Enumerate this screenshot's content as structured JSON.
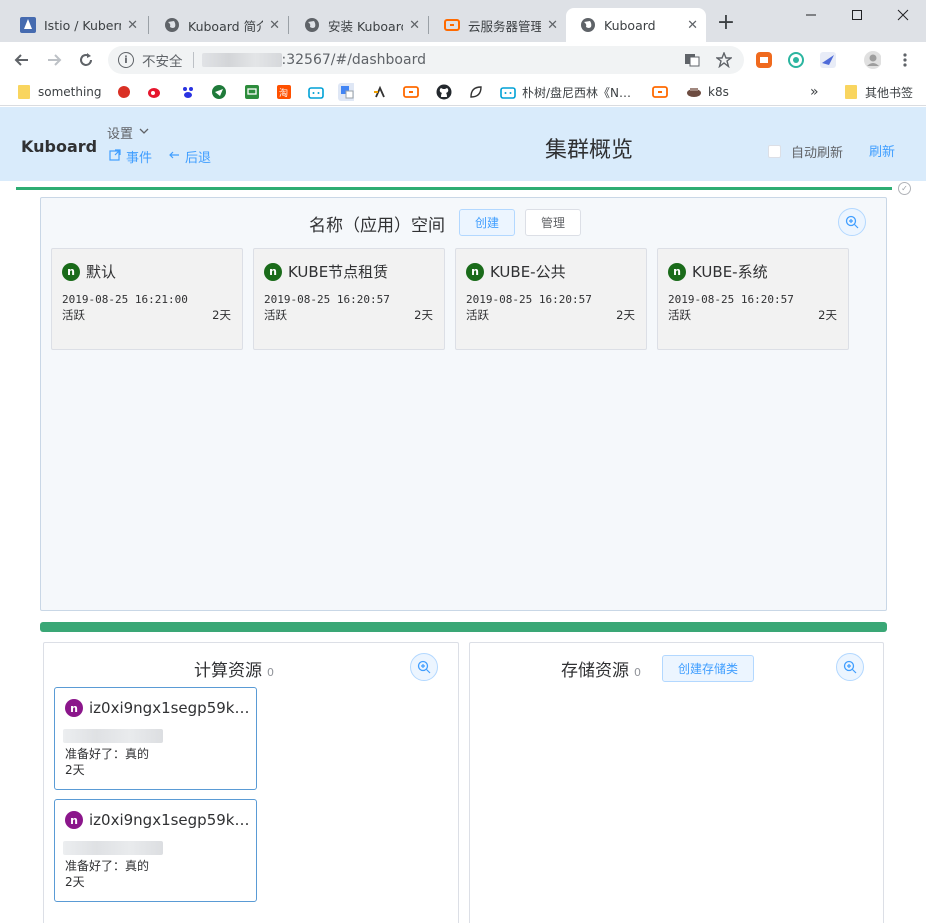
{
  "browser": {
    "tabs": [
      {
        "title": "Istio / Kubern",
        "icon": "istio-icon"
      },
      {
        "title": "Kuboard 简介",
        "icon": "globe-icon"
      },
      {
        "title": "安装 Kuboard",
        "icon": "globe-icon"
      },
      {
        "title": "云服务器管理",
        "icon": "aliyun-icon"
      },
      {
        "title": "Kuboard",
        "icon": "globe-icon"
      }
    ],
    "close_glyph": "✕",
    "new_tab_glyph": "+",
    "address": {
      "security_label": "不安全",
      "url_visible": ":32567/#/dashboard"
    },
    "bookmarks": [
      {
        "label": "something",
        "icon": "folder-icon"
      },
      {
        "label": "朴树/盘尼西林《N…",
        "icon": "bilibili-icon"
      },
      {
        "label": "k8s",
        "icon": "k8s-icon"
      }
    ],
    "bookmarks_overflow": "»",
    "other_bookmarks": "其他书签"
  },
  "header": {
    "brand": "Kuboard",
    "settings_label": "设置",
    "events_label": "事件",
    "back_label": "后退",
    "title": "集群概览",
    "auto_refresh_label": "自动刷新",
    "refresh_label": "刷新"
  },
  "namespaces": {
    "title": "名称（应用）空间",
    "create_label": "创建",
    "manage_label": "管理",
    "items": [
      {
        "name": "默认",
        "created": "2019-08-25 16:21:00",
        "status": "活跃",
        "age": "2天"
      },
      {
        "name": "KUBE节点租赁",
        "created": "2019-08-25 16:20:57",
        "status": "活跃",
        "age": "2天"
      },
      {
        "name": "KUBE-公共",
        "created": "2019-08-25 16:20:57",
        "status": "活跃",
        "age": "2天"
      },
      {
        "name": "KUBE-系统",
        "created": "2019-08-25 16:20:57",
        "status": "活跃",
        "age": "2天"
      }
    ]
  },
  "compute": {
    "title": "计算资源",
    "count": "0",
    "nodes": [
      {
        "name": "iz0xi9ngx1segp59k…",
        "ready": "准备好了：真的",
        "age": "2天"
      },
      {
        "name": "iz0xi9ngx1segp59k…",
        "ready": "准备好了：真的",
        "age": "2天"
      }
    ]
  },
  "storage": {
    "title": "存储资源",
    "count": "0",
    "create_label": "创建存储类"
  },
  "badge_letter": "n",
  "colors": {
    "header_bg": "#d9ebfb",
    "accent": "#409eff",
    "progress": "#2dad73",
    "divider": "#3aa776",
    "namespace_badge": "#1a6b1a",
    "node_badge": "#8b168b"
  }
}
